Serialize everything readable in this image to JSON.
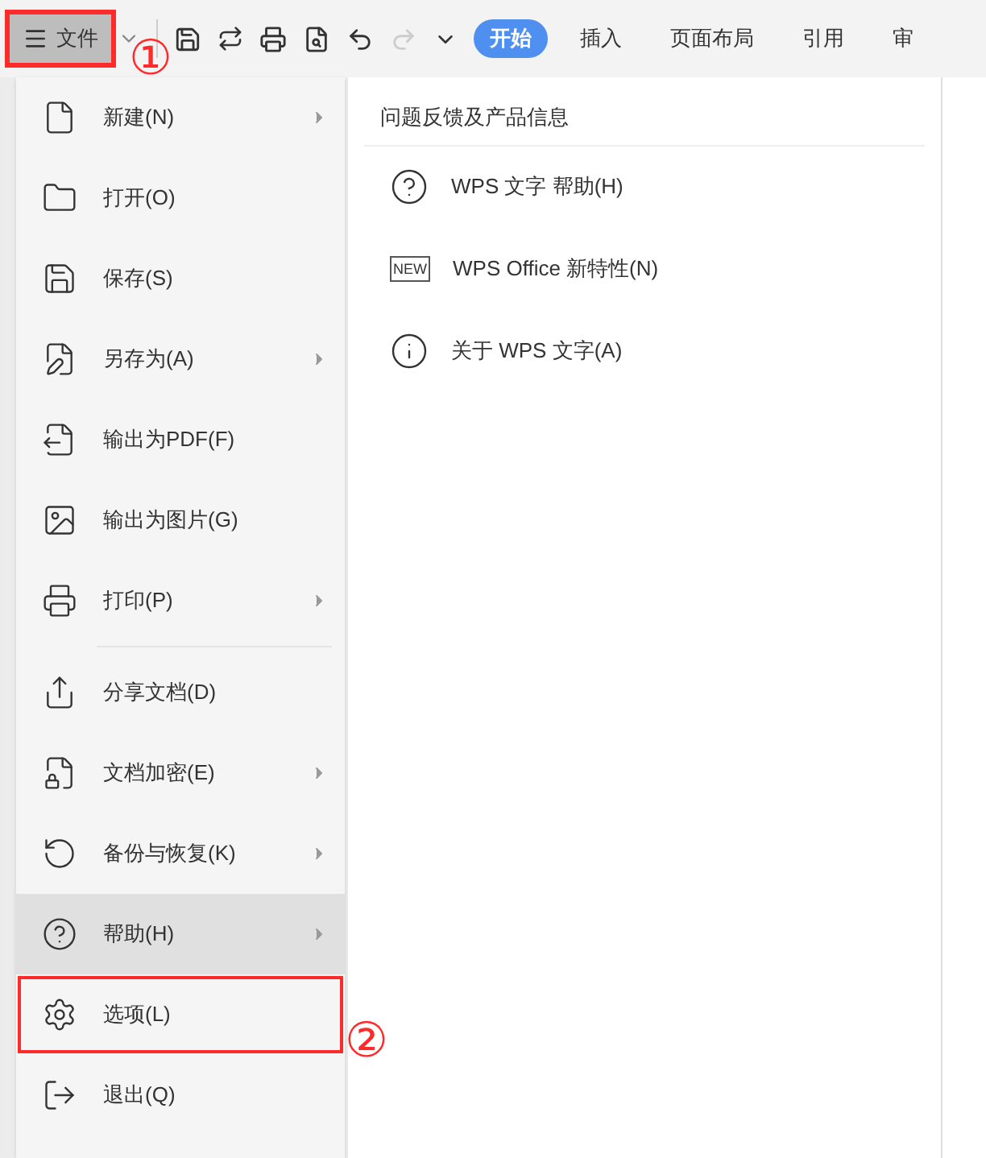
{
  "toolbar": {
    "file_button": {
      "label": "文件",
      "annotated": true
    },
    "redo_disabled": true,
    "tabs": [
      {
        "label": "开始",
        "selected": true
      },
      {
        "label": "插入",
        "selected": false
      },
      {
        "label": "页面布局",
        "selected": false
      },
      {
        "label": "引用",
        "selected": false
      },
      {
        "label": "审",
        "selected": false
      }
    ]
  },
  "file_menu": {
    "items": [
      {
        "kind": "new",
        "label": "新建(N)",
        "submenu": true,
        "hovered": false,
        "annotated": false
      },
      {
        "kind": "open",
        "label": "打开(O)",
        "submenu": false,
        "hovered": false,
        "annotated": false
      },
      {
        "kind": "save",
        "label": "保存(S)",
        "submenu": false,
        "hovered": false,
        "annotated": false
      },
      {
        "kind": "saveas",
        "label": "另存为(A)",
        "submenu": true,
        "hovered": false,
        "annotated": false
      },
      {
        "kind": "pdf",
        "label": "输出为PDF(F)",
        "submenu": false,
        "hovered": false,
        "annotated": false
      },
      {
        "kind": "image",
        "label": "输出为图片(G)",
        "submenu": false,
        "hovered": false,
        "annotated": false
      },
      {
        "kind": "print",
        "label": "打印(P)",
        "submenu": true,
        "hovered": false,
        "annotated": false
      },
      {
        "kind": "divider"
      },
      {
        "kind": "share",
        "label": "分享文档(D)",
        "submenu": false,
        "hovered": false,
        "annotated": false
      },
      {
        "kind": "encrypt",
        "label": "文档加密(E)",
        "submenu": true,
        "hovered": false,
        "annotated": false
      },
      {
        "kind": "backup",
        "label": "备份与恢复(K)",
        "submenu": true,
        "hovered": false,
        "annotated": false
      },
      {
        "kind": "help",
        "label": "帮助(H)",
        "submenu": true,
        "hovered": true,
        "annotated": false
      },
      {
        "kind": "options",
        "label": "选项(L)",
        "submenu": false,
        "hovered": false,
        "annotated": true
      },
      {
        "kind": "exit",
        "label": "退出(Q)",
        "submenu": false,
        "hovered": false,
        "annotated": false
      }
    ]
  },
  "submenu": {
    "heading": "问题反馈及产品信息",
    "items": [
      {
        "kind": "help",
        "label": "WPS 文字 帮助(H)"
      },
      {
        "kind": "new",
        "badge": "NEW",
        "label": "WPS Office 新特性(N)"
      },
      {
        "kind": "info",
        "label": "关于 WPS 文字(A)"
      }
    ]
  },
  "annotations": [
    {
      "label": "①"
    },
    {
      "label": "②"
    }
  ]
}
